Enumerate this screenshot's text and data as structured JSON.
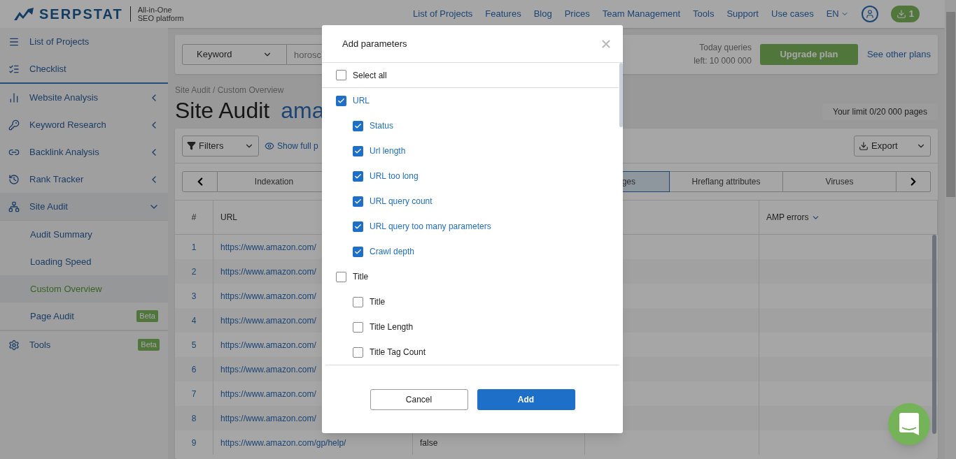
{
  "header": {
    "logo": "SERPSTAT",
    "tagline": [
      "All-in-One",
      "SEO platform"
    ],
    "nav": [
      "List of Projects",
      "Features",
      "Blog",
      "Prices",
      "Team Management",
      "Tools",
      "Support",
      "Use cases"
    ],
    "language": "EN",
    "downloads": "1"
  },
  "sidebar": {
    "items": [
      {
        "label": "List of Projects",
        "kind": "link"
      },
      {
        "label": "Checklist",
        "kind": "link"
      },
      {
        "label": "Website Analysis",
        "kind": "section",
        "expanded": false
      },
      {
        "label": "Keyword Research",
        "kind": "section",
        "expanded": false
      },
      {
        "label": "Backlink Analysis",
        "kind": "section",
        "expanded": false
      },
      {
        "label": "Rank Tracker",
        "kind": "section",
        "expanded": false
      },
      {
        "label": "Site Audit",
        "kind": "section",
        "expanded": true,
        "children": [
          {
            "label": "Audit Summary",
            "selected": false
          },
          {
            "label": "Loading Speed",
            "selected": false
          },
          {
            "label": "Custom Overview",
            "selected": true
          },
          {
            "label": "Page Audit",
            "selected": false,
            "badge": "Beta"
          }
        ]
      },
      {
        "label": "Tools",
        "kind": "link",
        "badge": "Beta"
      }
    ]
  },
  "search_bar": {
    "mode": "Keyword",
    "placeholder": "horosc",
    "queries": [
      "Today queries",
      "left: 10 000 000"
    ],
    "upgrade": "Upgrade plan",
    "plans_link": "See other plans"
  },
  "breadcrumb": "Site Audit / Custom Overview",
  "title": {
    "text": "Site Audit",
    "project": "ama"
  },
  "limit": "Your limit 0/20 000 pages",
  "toolbar": {
    "filters": "Filters",
    "show_full": "Show full p",
    "export": "Export"
  },
  "tabs": [
    {
      "label": "Indexation",
      "selected": false
    },
    {
      "label": "ges",
      "selected": true
    },
    {
      "label": "Hreflang attributes",
      "selected": false
    },
    {
      "label": "Viruses",
      "selected": false
    }
  ],
  "table": {
    "columns": [
      "#",
      "URL",
      "",
      "",
      "AMP errors"
    ],
    "rows": [
      {
        "n": "1",
        "url": "https://www.amazon.com/",
        "column_3": ""
      },
      {
        "n": "2",
        "url": "https://www.amazon.com/",
        "column_3": ""
      },
      {
        "n": "3",
        "url": "https://www.amazon.com/",
        "column_3": ""
      },
      {
        "n": "4",
        "url": "https://www.amazon.com/",
        "column_3": ""
      },
      {
        "n": "5",
        "url": "https://www.amazon.com/",
        "column_3": ""
      },
      {
        "n": "6",
        "url": "https://www.amazon.com/",
        "column_3": ""
      },
      {
        "n": "7",
        "url": "https://www.amazon.com/",
        "column_3": ""
      },
      {
        "n": "8",
        "url": "https://www.amazon.com/",
        "column_3": ""
      },
      {
        "n": "9",
        "url": "https://www.amazon.com/gp/help/",
        "column_3": "false"
      }
    ]
  },
  "dialog": {
    "title": "Add parameters",
    "select_all": {
      "label": "Select all",
      "checked": false
    },
    "groups": [
      {
        "label": "URL",
        "checked": true,
        "children": [
          {
            "label": "Status",
            "checked": true
          },
          {
            "label": "Url length",
            "checked": true
          },
          {
            "label": "URL too long",
            "checked": true
          },
          {
            "label": "URL query count",
            "checked": true
          },
          {
            "label": "URL query too many parameters",
            "checked": true
          },
          {
            "label": "Crawl depth",
            "checked": true
          }
        ]
      },
      {
        "label": "Title",
        "checked": false,
        "children": [
          {
            "label": "Title",
            "checked": false
          },
          {
            "label": "Title Length",
            "checked": false
          },
          {
            "label": "Title Tag Count",
            "checked": false
          }
        ]
      }
    ],
    "cancel": "Cancel",
    "add": "Add"
  }
}
